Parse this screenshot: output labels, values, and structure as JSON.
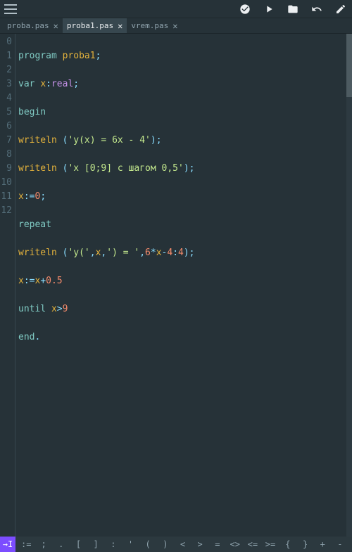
{
  "tabs": [
    {
      "label": "proba.pas",
      "close": "✕"
    },
    {
      "label": "proba1.pas",
      "close": "✕",
      "active": true
    },
    {
      "label": "vrem.pas",
      "close": "✕"
    }
  ],
  "lineNumbers": [
    "0",
    "1",
    "2",
    "3",
    "4",
    "5",
    "6",
    "7",
    "8",
    "9",
    "10",
    "11",
    "12"
  ],
  "code": {
    "l0": {
      "a": "program ",
      "b": "proba1",
      "c": ";"
    },
    "l1": {
      "a": "var ",
      "b": "x",
      "c": ":",
      "d": "real",
      "e": ";"
    },
    "l2": {
      "a": "begin"
    },
    "l3": {
      "a": "writeln ",
      "b": "(",
      "c": "'y(x) = 6x - 4'",
      "d": ")",
      "e": ";"
    },
    "l4": {
      "a": "writeln ",
      "b": "(",
      "c": "'x [0;9] с шагом 0,5'",
      "d": ")",
      "e": ";"
    },
    "l5": {
      "a": "x",
      "b": ":=",
      "c": "0",
      "d": ";"
    },
    "l6": {
      "a": "repeat"
    },
    "l7": {
      "a": "writeln ",
      "b": "(",
      "c": "'y('",
      "d": ",",
      "e": "x",
      "f": ",",
      "g": "') = '",
      "h": ",",
      "i": "6",
      "j": "*",
      "k": "x",
      "l": "-",
      "m": "4",
      "n": ":",
      "o": "4",
      "p": ")",
      "q": ";"
    },
    "l8": {
      "a": "x",
      "b": ":=",
      "c": "x",
      "d": "+",
      "e": "0.5"
    },
    "l9": {
      "a": "until ",
      "b": "x",
      "c": ">",
      "d": "9"
    },
    "l10": {
      "a": "end",
      "b": "."
    }
  },
  "symbolbar": {
    "lead": "→I",
    "keys": [
      ":=",
      ";",
      ".",
      "[",
      "]",
      ":",
      "'",
      "(",
      ")",
      "<",
      ">",
      "=",
      "<>",
      "<=",
      ">=",
      "{",
      "}",
      "+",
      "-"
    ]
  }
}
